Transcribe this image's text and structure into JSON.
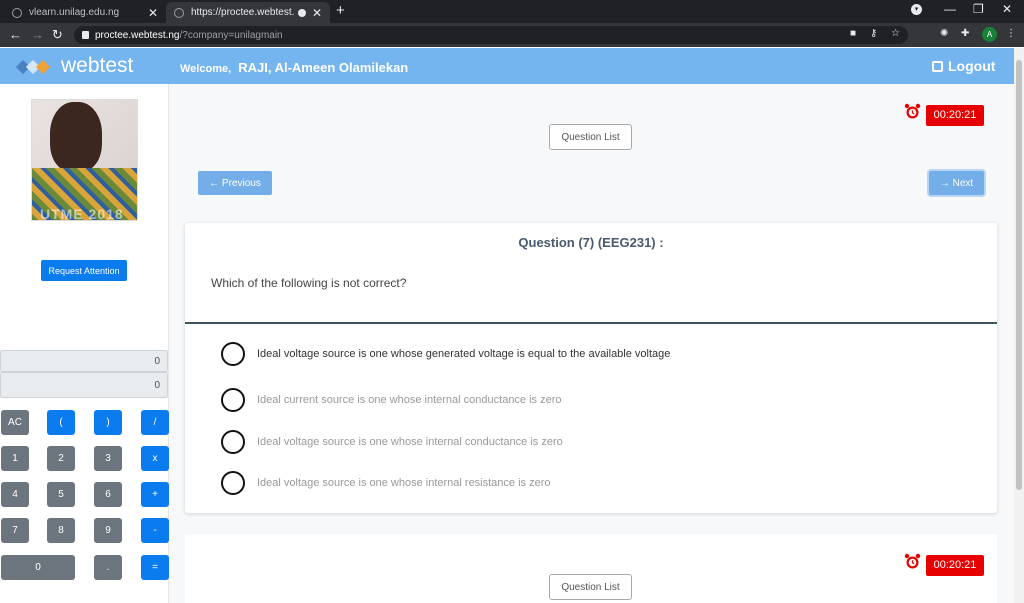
{
  "browser": {
    "tabs": [
      {
        "title": "vlearn.unilag.edu.ng"
      },
      {
        "title": "https://proctee.webtest.ng/?"
      }
    ],
    "url_host": "proctee.webtest.ng",
    "url_path": "/?company=unilagmain",
    "profile_initial": "A"
  },
  "header": {
    "logo_text": "webtest",
    "welcome_label": "Welcome,",
    "user_name": "RAJI, Al-Ameen Olamilekan",
    "logout_label": "Logout"
  },
  "sidebar": {
    "photo_stamp": "UTME 2018",
    "request_attention_label": "Request Attention",
    "calculator": {
      "display_top": "0",
      "display_bottom": "0",
      "keys": {
        "ac": "AC",
        "lparen": "(",
        "rparen": ")",
        "div": "/",
        "k1": "1",
        "k2": "2",
        "k3": "3",
        "mul": "x",
        "k4": "4",
        "k5": "5",
        "k6": "6",
        "add": "+",
        "k7": "7",
        "k8": "8",
        "k9": "9",
        "sub": "-",
        "k0": "0",
        "dot": ".",
        "eq": "="
      }
    }
  },
  "main": {
    "timer": "00:20:21",
    "question_list_label": "Question List",
    "previous_label": "← Previous",
    "next_label": "→ Next",
    "question_title": "Question (7) (EEG231) :",
    "question_text": "Which of the following is not correct?",
    "options": [
      {
        "label": "Ideal voltage source is one whose generated voltage is equal to the available voltage"
      },
      {
        "label": "Ideal current source is one whose internal conductance is zero"
      },
      {
        "label": "Ideal voltage source is one whose internal conductance is zero"
      },
      {
        "label": "Ideal voltage source is one whose internal resistance is zero"
      }
    ]
  },
  "colors": {
    "header_bg": "#74b4ef",
    "timer_bg": "#e60000",
    "primary_button": "#0b7bf0",
    "nav_button": "#74aee8"
  }
}
